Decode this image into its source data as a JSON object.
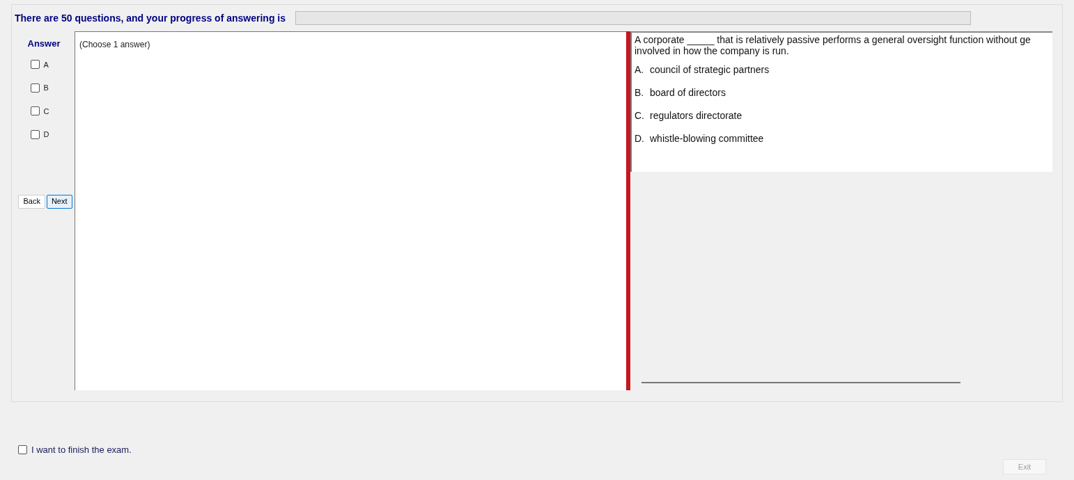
{
  "header": {
    "text": "There are 50 questions, and your progress of answering is",
    "progress": {
      "level": 0
    }
  },
  "answer_panel": {
    "title": "Answer",
    "options": [
      {
        "label": "A",
        "checked": false
      },
      {
        "label": "B",
        "checked": false
      },
      {
        "label": "C",
        "checked": false
      },
      {
        "label": "D",
        "checked": false
      }
    ],
    "buttons": [
      {
        "label": "Back",
        "kind": "plain"
      },
      {
        "label": "Next",
        "kind": "focused"
      }
    ]
  },
  "answer_text": "(Choose 1 answer)",
  "question": {
    "lines": [
      "A corporate _____ that is relatively passive performs a general oversight function without ge",
      "involved in how the company is run."
    ],
    "choices": [
      {
        "letter": "A.",
        "text": "council of strategic partners"
      },
      {
        "letter": "B.",
        "text": "board of directors"
      },
      {
        "letter": "C.",
        "text": "regulators directorate"
      },
      {
        "letter": "D.",
        "text": "whistle-blowing committee"
      }
    ]
  },
  "finish": {
    "label": "I want to finish the exam.",
    "checked": false
  },
  "exit_button": {
    "label": "Exit",
    "disabled": true
  }
}
